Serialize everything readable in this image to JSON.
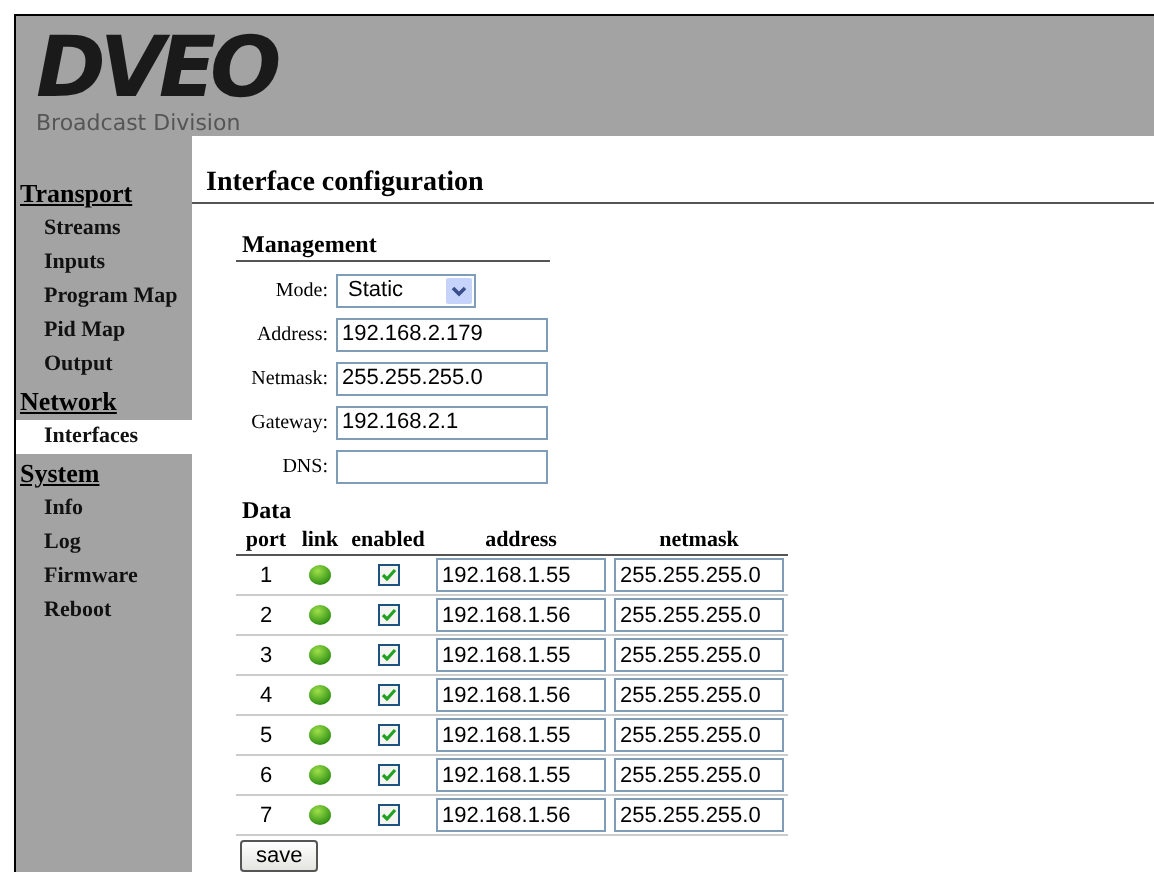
{
  "logo": {
    "mark": "DVEO",
    "subtitle": "Broadcast Division"
  },
  "sidebar": [
    {
      "label": "Transport",
      "items": [
        {
          "label": "Streams",
          "selected": false
        },
        {
          "label": "Inputs",
          "selected": false
        },
        {
          "label": "Program Map",
          "selected": false
        },
        {
          "label": "Pid Map",
          "selected": false
        },
        {
          "label": "Output",
          "selected": false
        }
      ]
    },
    {
      "label": "Network",
      "items": [
        {
          "label": "Interfaces",
          "selected": true
        }
      ]
    },
    {
      "label": "System",
      "items": [
        {
          "label": "Info",
          "selected": false
        },
        {
          "label": "Log",
          "selected": false
        },
        {
          "label": "Firmware",
          "selected": false
        },
        {
          "label": "Reboot",
          "selected": false
        }
      ]
    }
  ],
  "title": "Interface configuration",
  "management": {
    "heading": "Management",
    "fields": [
      {
        "kind": "select",
        "label": "Mode:",
        "value": "Static"
      },
      {
        "kind": "text",
        "label": "Address:",
        "value": "192.168.2.179"
      },
      {
        "kind": "text",
        "label": "Netmask:",
        "value": "255.255.255.0"
      },
      {
        "kind": "text",
        "label": "Gateway:",
        "value": "192.168.2.1"
      },
      {
        "kind": "text",
        "label": "DNS:"
      }
    ]
  },
  "data": {
    "heading": "Data",
    "columns": [
      "port",
      "link",
      "enabled",
      "address",
      "netmask"
    ],
    "rows": [
      {
        "port": "1",
        "link": true,
        "enabled": true,
        "address": "192.168.1.55",
        "netmask": "255.255.255.0"
      },
      {
        "port": "2",
        "link": true,
        "enabled": true,
        "address": "192.168.1.56",
        "netmask": "255.255.255.0"
      },
      {
        "port": "3",
        "link": true,
        "enabled": true,
        "address": "192.168.1.55",
        "netmask": "255.255.255.0"
      },
      {
        "port": "4",
        "link": true,
        "enabled": true,
        "address": "192.168.1.56",
        "netmask": "255.255.255.0"
      },
      {
        "port": "5",
        "link": true,
        "enabled": true,
        "address": "192.168.1.55",
        "netmask": "255.255.255.0"
      },
      {
        "port": "6",
        "link": true,
        "enabled": true,
        "address": "192.168.1.55",
        "netmask": "255.255.255.0"
      },
      {
        "port": "7",
        "link": true,
        "enabled": true,
        "address": "192.168.1.56",
        "netmask": "255.255.255.0"
      }
    ]
  },
  "save_button": "save"
}
